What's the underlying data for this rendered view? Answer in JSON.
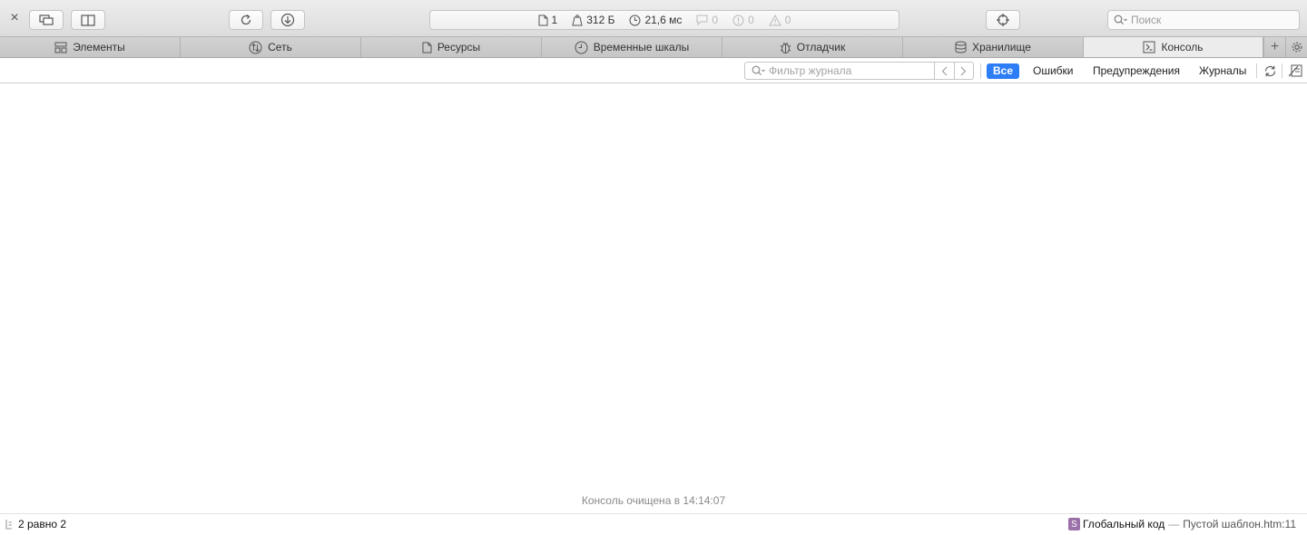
{
  "toolbar": {
    "close_glyph": "×",
    "status": {
      "resources": "1",
      "size": "312 Б",
      "time": "21,6 мс",
      "logs": "0",
      "errors": "0",
      "warnings": "0"
    },
    "search_placeholder": "Поиск"
  },
  "tabs": [
    {
      "label": "Элементы",
      "icon": "elements-icon"
    },
    {
      "label": "Сеть",
      "icon": "network-icon"
    },
    {
      "label": "Ресурсы",
      "icon": "resources-icon"
    },
    {
      "label": "Временные шкалы",
      "icon": "timelines-icon"
    },
    {
      "label": "Отладчик",
      "icon": "debugger-icon"
    },
    {
      "label": "Хранилище",
      "icon": "storage-icon"
    },
    {
      "label": "Консоль",
      "icon": "console-icon",
      "active": true
    }
  ],
  "filterbar": {
    "filter_placeholder": "Фильтр журнала",
    "scopes": [
      "Все",
      "Ошибки",
      "Предупреждения",
      "Журналы"
    ],
    "selected_scope": "Все"
  },
  "console": {
    "cleared_message": "Консоль очищена в 14:14:07"
  },
  "bottombar": {
    "last_result": "2 равно 2",
    "frame_badge": "S",
    "frame_name": "Глобальный код",
    "frame_separator": "—",
    "frame_location": "Пустой шаблон.htm:11"
  },
  "colors": {
    "accent": "#2d7df6",
    "frame_badge": "#9b6fa8"
  }
}
